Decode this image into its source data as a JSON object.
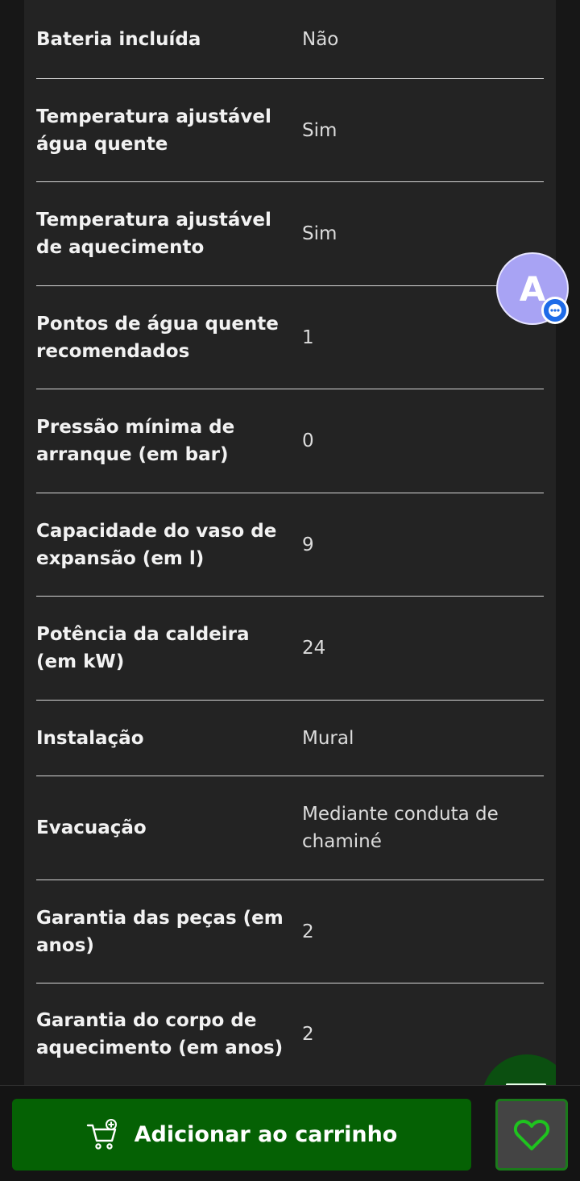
{
  "specs": [
    {
      "label": "Bateria incluída",
      "value": "Não"
    },
    {
      "label": "Temperatura ajustável água quente",
      "value": "Sim"
    },
    {
      "label": "Temperatura ajustável de aquecimento",
      "value": "Sim"
    },
    {
      "label": "Pontos de água quente recomendados",
      "value": "1"
    },
    {
      "label": "Pressão mínima de arranque (em bar)",
      "value": "0"
    },
    {
      "label": "Capacidade do vaso de expansão (em l)",
      "value": "9"
    },
    {
      "label": "Potência da caldeira (em kW)",
      "value": "24"
    },
    {
      "label": "Instalação",
      "value": "Mural"
    },
    {
      "label": "Evacuação",
      "value": "Mediante conduta de chaminé"
    },
    {
      "label": "Garantia das peças (em anos)",
      "value": "2"
    },
    {
      "label": "Garantia do corpo de aquecimento (em anos)",
      "value": "2"
    }
  ],
  "avatar": {
    "letter": "A",
    "color": "#a8a3f4",
    "badge_icon": "chat-bubble-icon",
    "badge_color": "#1e6be8"
  },
  "cart_button": {
    "label": "Adicionar ao carrinho",
    "icon": "cart-add-icon",
    "color": "#056104"
  },
  "favorite_button": {
    "icon": "heart-icon",
    "color": "#1b7a1b"
  }
}
